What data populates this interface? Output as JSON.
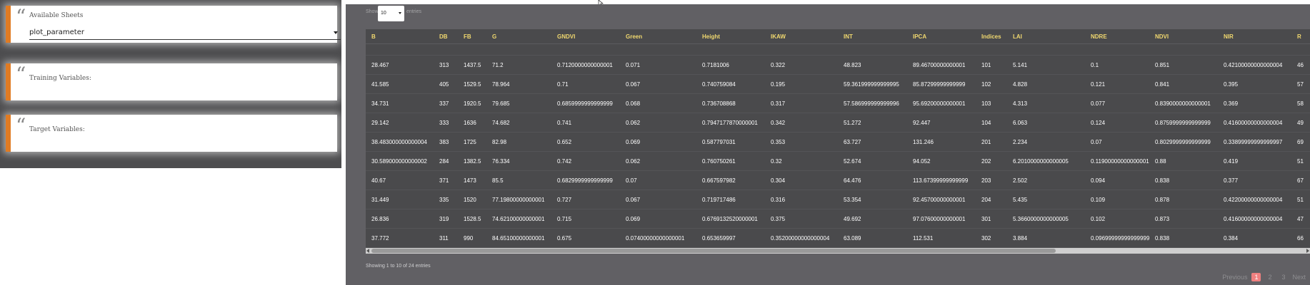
{
  "left_panel": {
    "sheets_label": "Available Sheets",
    "sheets_value": "plot_parameter",
    "training_label": "Training Variables:",
    "target_label": "Target Variables:"
  },
  "table_controls": {
    "show_label": "Show",
    "entries_value": "10",
    "entries_label": "entries"
  },
  "table": {
    "headers": [
      "B",
      "DB",
      "FB",
      "G",
      "GNDVI",
      "Green",
      "Height",
      "IKAW",
      "INT",
      "IPCA",
      "Indices",
      "LAI",
      "NDRE",
      "NDVI",
      "NIR",
      "R"
    ],
    "rows": [
      [
        "28.467",
        "313",
        "1437.5",
        "71.2",
        "0.7120000000000001",
        "0.071",
        "0.7181006",
        "0.322",
        "48.823",
        "89.46700000000001",
        "101",
        "5.141",
        "0.1",
        "0.851",
        "0.42100000000000004",
        "46"
      ],
      [
        "41.585",
        "405",
        "1529.5",
        "78.964",
        "0.71",
        "0.067",
        "0.740759084",
        "0.195",
        "59.361999999999995",
        "85.87299999999999",
        "102",
        "4.828",
        "0.121",
        "0.841",
        "0.395",
        "57"
      ],
      [
        "34.731",
        "337",
        "1920.5",
        "79.685",
        "0.6859999999999999",
        "0.068",
        "0.736708868",
        "0.317",
        "57.586999999999996",
        "95.69200000000001",
        "103",
        "4.313",
        "0.077",
        "0.8390000000000001",
        "0.369",
        "58"
      ],
      [
        "29.142",
        "333",
        "1636",
        "74.682",
        "0.741",
        "0.062",
        "0.7947177870000001",
        "0.342",
        "51.272",
        "92.447",
        "104",
        "6.063",
        "0.124",
        "0.8759999999999999",
        "0.41600000000000004",
        "49"
      ],
      [
        "38.483000000000004",
        "383",
        "1725",
        "82.98",
        "0.652",
        "0.069",
        "0.587797031",
        "0.353",
        "63.727",
        "131.246",
        "201",
        "2.234",
        "0.07",
        "0.8029999999999999",
        "0.33899999999999997",
        "69"
      ],
      [
        "30.589000000000002",
        "284",
        "1382.5",
        "76.334",
        "0.742",
        "0.062",
        "0.760750261",
        "0.32",
        "52.674",
        "94.052",
        "202",
        "6.2010000000000005",
        "0.11900000000000001",
        "0.88",
        "0.419",
        "51"
      ],
      [
        "40.67",
        "371",
        "1473",
        "85.5",
        "0.6829999999999999",
        "0.07",
        "0.667597982",
        "0.304",
        "64.476",
        "113.67399999999999",
        "203",
        "2.502",
        "0.094",
        "0.838",
        "0.377",
        "67"
      ],
      [
        "31.449",
        "335",
        "1520",
        "77.19800000000001",
        "0.727",
        "0.067",
        "0.719717486",
        "0.316",
        "53.354",
        "92.45700000000001",
        "204",
        "5.435",
        "0.109",
        "0.878",
        "0.42200000000000004",
        "51"
      ],
      [
        "26.836",
        "319",
        "1528.5",
        "74.62100000000001",
        "0.715",
        "0.069",
        "0.6769132520000001",
        "0.375",
        "49.692",
        "97.07600000000001",
        "301",
        "5.3660000000000005",
        "0.102",
        "0.873",
        "0.41600000000000004",
        "47"
      ],
      [
        "37.772",
        "311",
        "990",
        "84.65100000000001",
        "0.675",
        "0.07400000000000001",
        "0.653659997",
        "0.35200000000000004",
        "63.089",
        "112.531",
        "302",
        "3.884",
        "0.09699999999999999",
        "0.838",
        "0.384",
        "66"
      ]
    ]
  },
  "info_text": "Showing 1 to 10 of 24 entries",
  "pagination": {
    "previous": "Previous",
    "pages": [
      "1",
      "2",
      "3"
    ],
    "next": "Next"
  },
  "colors": {
    "accent": "#e07b23",
    "header_text": "#f0d86f",
    "active_page": "#f08080"
  }
}
